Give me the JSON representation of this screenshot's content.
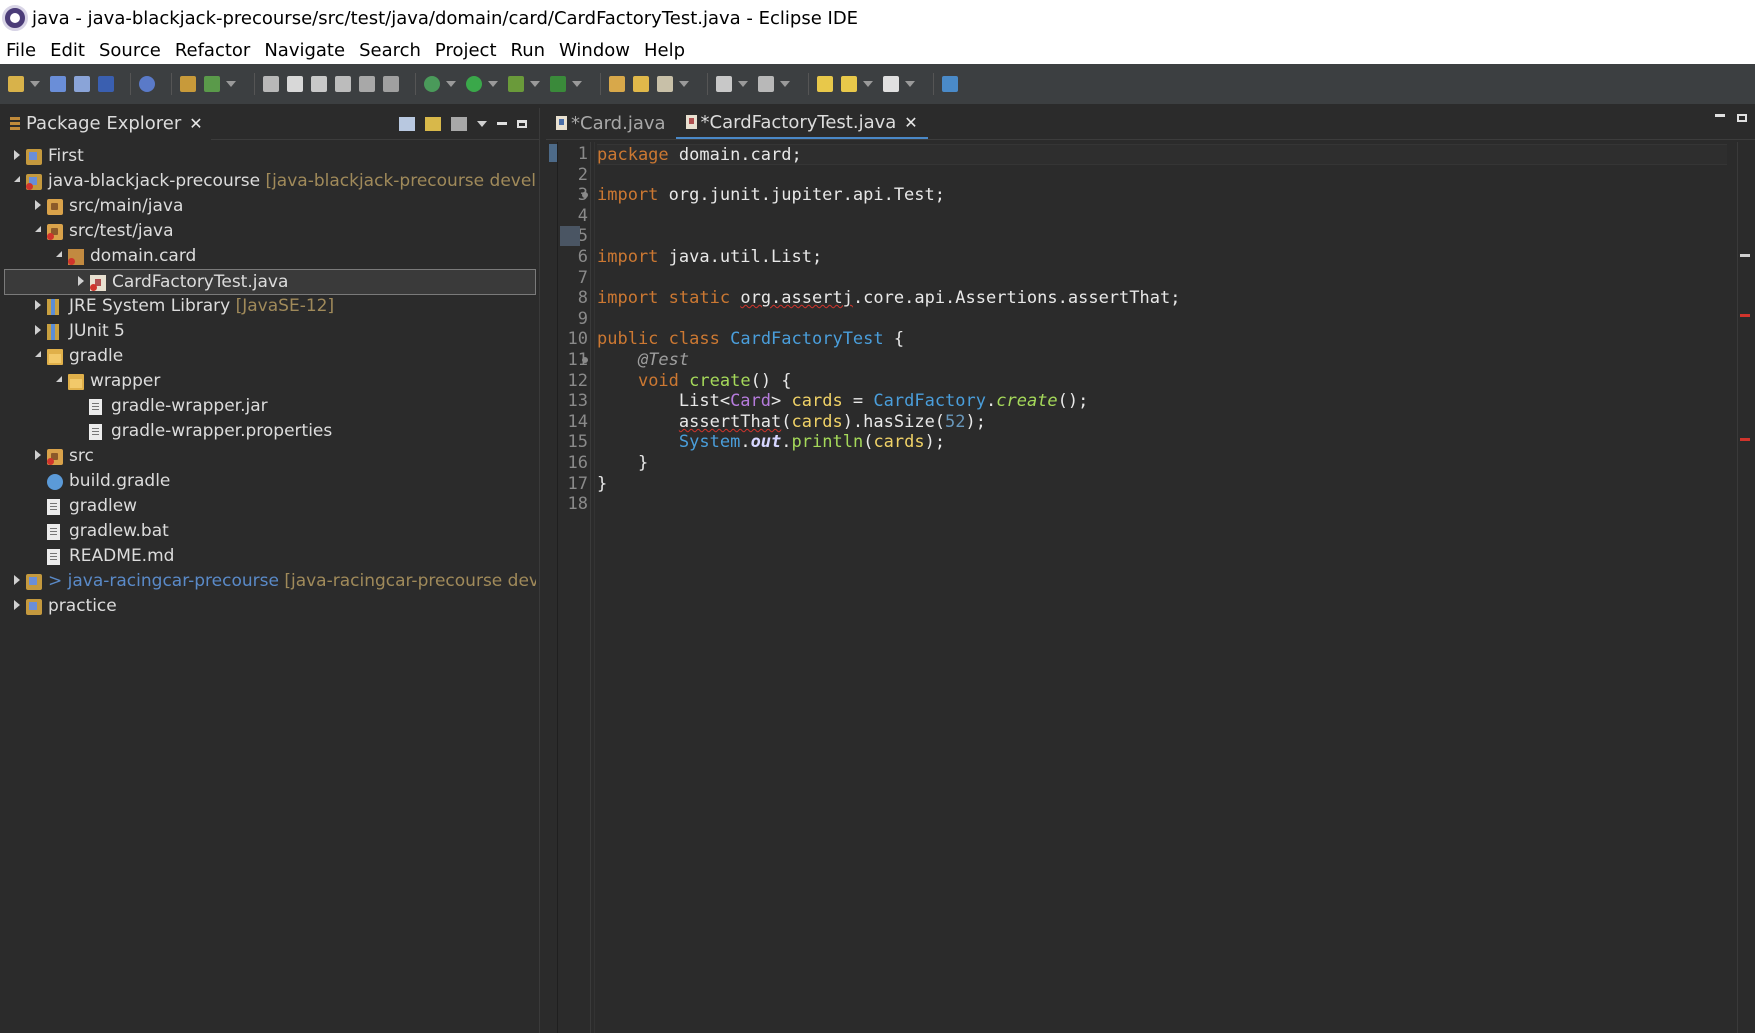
{
  "window": {
    "title": "java - java-blackjack-precourse/src/test/java/domain/card/CardFactoryTest.java - Eclipse IDE"
  },
  "menu": [
    "File",
    "Edit",
    "Source",
    "Refactor",
    "Navigate",
    "Search",
    "Project",
    "Run",
    "Window",
    "Help"
  ],
  "toolbar": {
    "icons": [
      "new-icon",
      "save-icon",
      "save-all-icon",
      "terminal-icon",
      "skip-breakpoints-icon",
      "new-java-project-icon",
      "refresh-icon",
      "new-class-icon",
      "open-type-icon",
      "pen-icon",
      "search-icon",
      "toggle-mark-icon",
      "show-whitespace-icon",
      "debug-icon",
      "run-icon",
      "coverage-icon",
      "external-tools-icon",
      "open-task-icon",
      "open-folder-icon",
      "brush-icon",
      "next-annotation-icon",
      "prev-annotation-icon",
      "last-edit-icon",
      "back-icon",
      "forward-icon",
      "perspective-icon"
    ]
  },
  "package_explorer": {
    "tab_label": "Package Explorer",
    "tree": [
      {
        "label": "First",
        "deco": "",
        "icon": "project",
        "level": 0,
        "state": "collapsed"
      },
      {
        "label": "java-blackjack-precourse",
        "deco": "[java-blackjack-precourse develop]",
        "icon": "project-err",
        "level": 0,
        "state": "expanded"
      },
      {
        "label": "src/main/java",
        "deco": "",
        "icon": "srcfolder",
        "level": 1,
        "state": "collapsed"
      },
      {
        "label": "src/test/java",
        "deco": "",
        "icon": "srcfolder-err",
        "level": 1,
        "state": "expanded"
      },
      {
        "label": "domain.card",
        "deco": "",
        "icon": "package",
        "level": 2,
        "state": "expanded"
      },
      {
        "label": "CardFactoryTest.java",
        "deco": "",
        "icon": "javafile",
        "level": 3,
        "state": "collapsed",
        "selected": true
      },
      {
        "label": "JRE System Library",
        "deco": "[JavaSE-12]",
        "icon": "library",
        "level": 1,
        "state": "collapsed"
      },
      {
        "label": "JUnit 5",
        "deco": "",
        "icon": "library",
        "level": 1,
        "state": "collapsed"
      },
      {
        "label": "gradle",
        "deco": "",
        "icon": "folder",
        "level": 1,
        "state": "expanded"
      },
      {
        "label": "wrapper",
        "deco": "",
        "icon": "folder",
        "level": 2,
        "state": "expanded"
      },
      {
        "label": "gradle-wrapper.jar",
        "deco": "",
        "icon": "file",
        "level": 3,
        "state": "none"
      },
      {
        "label": "gradle-wrapper.properties",
        "deco": "",
        "icon": "file",
        "level": 3,
        "state": "none"
      },
      {
        "label": "src",
        "deco": "",
        "icon": "srcfolder-err",
        "level": 1,
        "state": "collapsed"
      },
      {
        "label": "build.gradle",
        "deco": "",
        "icon": "gradle",
        "level": 1,
        "state": "none"
      },
      {
        "label": "gradlew",
        "deco": "",
        "icon": "file",
        "level": 1,
        "state": "none"
      },
      {
        "label": "gradlew.bat",
        "deco": "",
        "icon": "file",
        "level": 1,
        "state": "none"
      },
      {
        "label": "README.md",
        "deco": "",
        "icon": "file",
        "level": 1,
        "state": "none"
      },
      {
        "label": "> java-racingcar-precourse",
        "deco": "[java-racingcar-precourse develop]",
        "icon": "project",
        "level": 0,
        "state": "collapsed",
        "link": true
      },
      {
        "label": "practice",
        "deco": "",
        "icon": "project",
        "level": 0,
        "state": "collapsed"
      }
    ]
  },
  "editor": {
    "tabs": [
      {
        "label": "*Card.java",
        "active": false
      },
      {
        "label": "*CardFactoryTest.java",
        "active": true
      }
    ],
    "line_numbers": [
      "1",
      "2",
      "3",
      "4",
      "5",
      "6",
      "7",
      "8",
      "9",
      "10",
      "11",
      "12",
      "13",
      "14",
      "15",
      "16",
      "17",
      "18"
    ],
    "lines": [
      "package domain.card;",
      "",
      "import org.junit.jupiter.api.Test;",
      "",
      "",
      "import java.util.List;",
      "",
      "import static org.assertj.core.api.Assertions.assertThat;",
      "",
      "public class CardFactoryTest {",
      "    @Test",
      "    void create() {",
      "        List<Card> cards = CardFactory.create();",
      "        assertThat(cards).hasSize(52);",
      "        System.out.println(cards);",
      "    }",
      "}",
      ""
    ]
  },
  "colors": {
    "keyword": "#cc7832",
    "type": "#4a9edb",
    "variable": "#f0d267",
    "method": "#a5d95a",
    "number": "#6897bb",
    "error": "#d0342c",
    "background": "#2b2b2b"
  }
}
